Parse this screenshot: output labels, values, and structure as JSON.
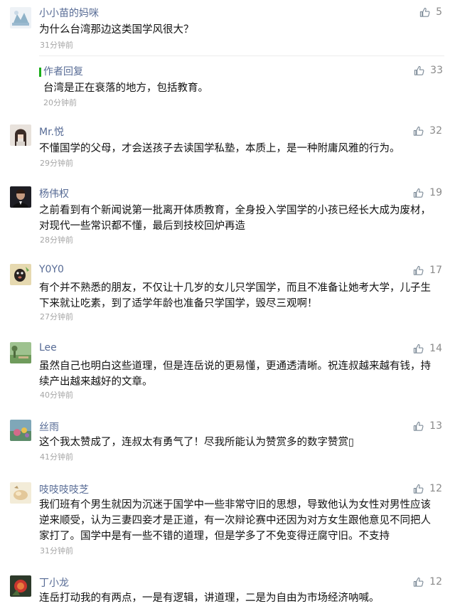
{
  "comments": [
    {
      "user": "小小苗的妈咪",
      "text": "为什么台湾那边这类国学风很大？",
      "time": "31分钟前",
      "likes": "5",
      "author_reply": {
        "label": "作者回复",
        "text": "台湾是正在衰落的地方，包括教育。",
        "time": "20分钟前",
        "likes": "33"
      }
    },
    {
      "user": "Mr.悦",
      "text": "不懂国学的父母，才会送孩子去读国学私塾，本质上，是一种附庸风雅的行为。",
      "time": "29分钟前",
      "likes": "32"
    },
    {
      "user": "杨伟权",
      "text": "之前看到有个新闻说第一批离开体质教育，全身投入学国学的小孩已经长大成为废材，对现代一些常识都不懂，最后到技校回炉再造",
      "time": "28分钟前",
      "likes": "19"
    },
    {
      "user": "Y0Y0",
      "text": "有个并不熟悉的朋友，不仅让十几岁的女儿只学国学，而且不准备让她考大学，儿子生下来就让吃素，到了适学年龄也准备只学国学，毁尽三观啊！",
      "time": "27分钟前",
      "likes": "17"
    },
    {
      "user": "Lee",
      "text": "虽然自己也明白这些道理，但是连岳说的更易懂，更通透清晰。祝连叔越来越有钱，持续产出越来越好的文章。",
      "time": "40分钟前",
      "likes": "14"
    },
    {
      "user": "丝雨",
      "text": "这个我太赞成了，连叔太有勇气了！尽我所能认为赞赏多的数字赞赏▯",
      "time": "41分钟前",
      "likes": "13"
    },
    {
      "user": "吱吱吱吱芝",
      "text": "我们班有个男生就因为沉迷于国学中一些非常守旧的思想，导致他认为女性对男性应该逆来顺受，认为三妻四妾才是正道，有一次辩论赛中还因为对方女生跟他意见不同把人家打了。国学中是有一些不错的道理，但是学多了不免变得迂腐守旧。不支持",
      "time": "31分钟前",
      "likes": "12"
    },
    {
      "user": "丁小龙",
      "text": "连岳打动我的有两点，一是有逻辑，讲道理，二是为自由为市场经济呐喊。",
      "time": "",
      "likes": "12"
    }
  ],
  "colors": {
    "username": "#576b95",
    "time": "#a6a6a6",
    "reply_bar": "#1aad19"
  },
  "icons": {
    "like": "thumbs-up-icon"
  }
}
